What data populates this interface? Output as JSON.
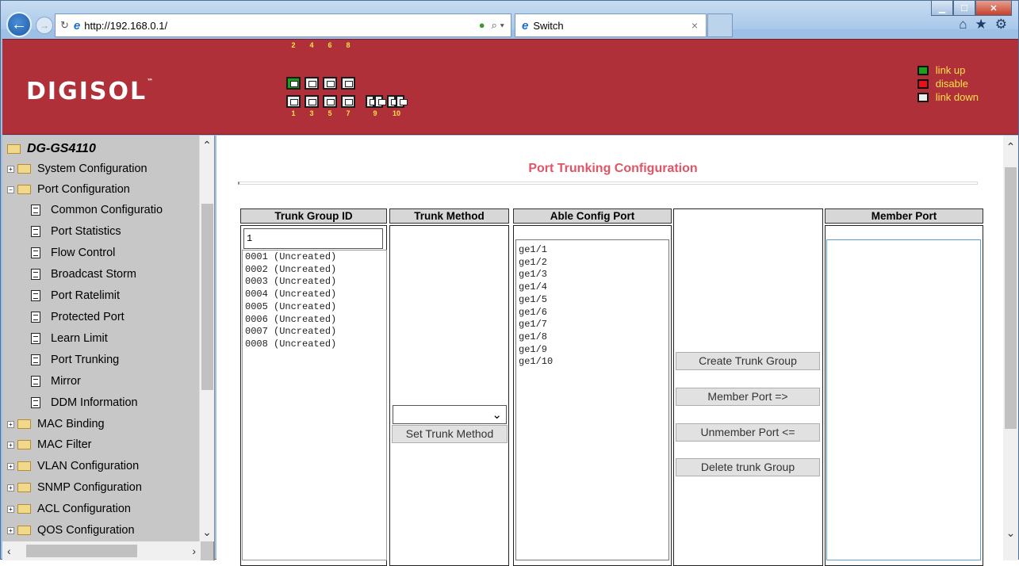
{
  "browser": {
    "url": "http://192.168.0.1/",
    "tab_title": "Switch"
  },
  "header": {
    "brand": "DIGISOL",
    "trademark": "™",
    "top_port_labels": [
      "2",
      "4",
      "6",
      "8"
    ],
    "bottom_port_labels": [
      "1",
      "3",
      "5",
      "7",
      "9",
      "10"
    ],
    "legend": [
      {
        "label": "link up",
        "color": "#1aa31a"
      },
      {
        "label": "disable",
        "color": "#e8101a"
      },
      {
        "label": "link down",
        "color": "#eeeeee"
      }
    ]
  },
  "sidebar": {
    "root": "DG-GS4110",
    "items": [
      {
        "label": "System Configuration",
        "type": "folder",
        "state": "collapsed"
      },
      {
        "label": "Port Configuration",
        "type": "folder",
        "state": "expanded"
      },
      {
        "label": "Common Configuratio",
        "type": "page"
      },
      {
        "label": "Port Statistics",
        "type": "page"
      },
      {
        "label": "Flow Control",
        "type": "page"
      },
      {
        "label": "Broadcast Storm",
        "type": "page"
      },
      {
        "label": "Port Ratelimit",
        "type": "page"
      },
      {
        "label": "Protected Port",
        "type": "page"
      },
      {
        "label": "Learn Limit",
        "type": "page"
      },
      {
        "label": "Port Trunking",
        "type": "page"
      },
      {
        "label": "Mirror",
        "type": "page"
      },
      {
        "label": "DDM Information",
        "type": "page"
      },
      {
        "label": "MAC Binding",
        "type": "folder",
        "state": "collapsed"
      },
      {
        "label": "MAC Filter",
        "type": "folder",
        "state": "collapsed"
      },
      {
        "label": "VLAN Configuration",
        "type": "folder",
        "state": "collapsed"
      },
      {
        "label": "SNMP Configuration",
        "type": "folder",
        "state": "collapsed"
      },
      {
        "label": "ACL Configuration",
        "type": "folder",
        "state": "collapsed"
      },
      {
        "label": "QOS Configuration",
        "type": "folder",
        "state": "collapsed"
      }
    ]
  },
  "main": {
    "title": "Port Trunking Configuration",
    "columns": {
      "group_id": "Trunk Group ID",
      "method": "Trunk Method",
      "able": "Able Config Port",
      "member": "Member Port"
    },
    "group_id_value": "1",
    "groups": [
      "0001  (Uncreated)",
      "0002  (Uncreated)",
      "0003  (Uncreated)",
      "0004  (Uncreated)",
      "0005  (Uncreated)",
      "0006  (Uncreated)",
      "0007  (Uncreated)",
      "0008  (Uncreated)"
    ],
    "able_ports": [
      "ge1/1",
      "ge1/2",
      "ge1/3",
      "ge1/4",
      "ge1/5",
      "ge1/6",
      "ge1/7",
      "ge1/8",
      "ge1/9",
      "ge1/10"
    ],
    "method_selected": "",
    "buttons": {
      "set_method": "Set Trunk Method",
      "create": "Create Trunk Group",
      "member": "Member Port =>",
      "unmember": "Unmember Port <=",
      "delete": "Delete trunk Group"
    }
  }
}
